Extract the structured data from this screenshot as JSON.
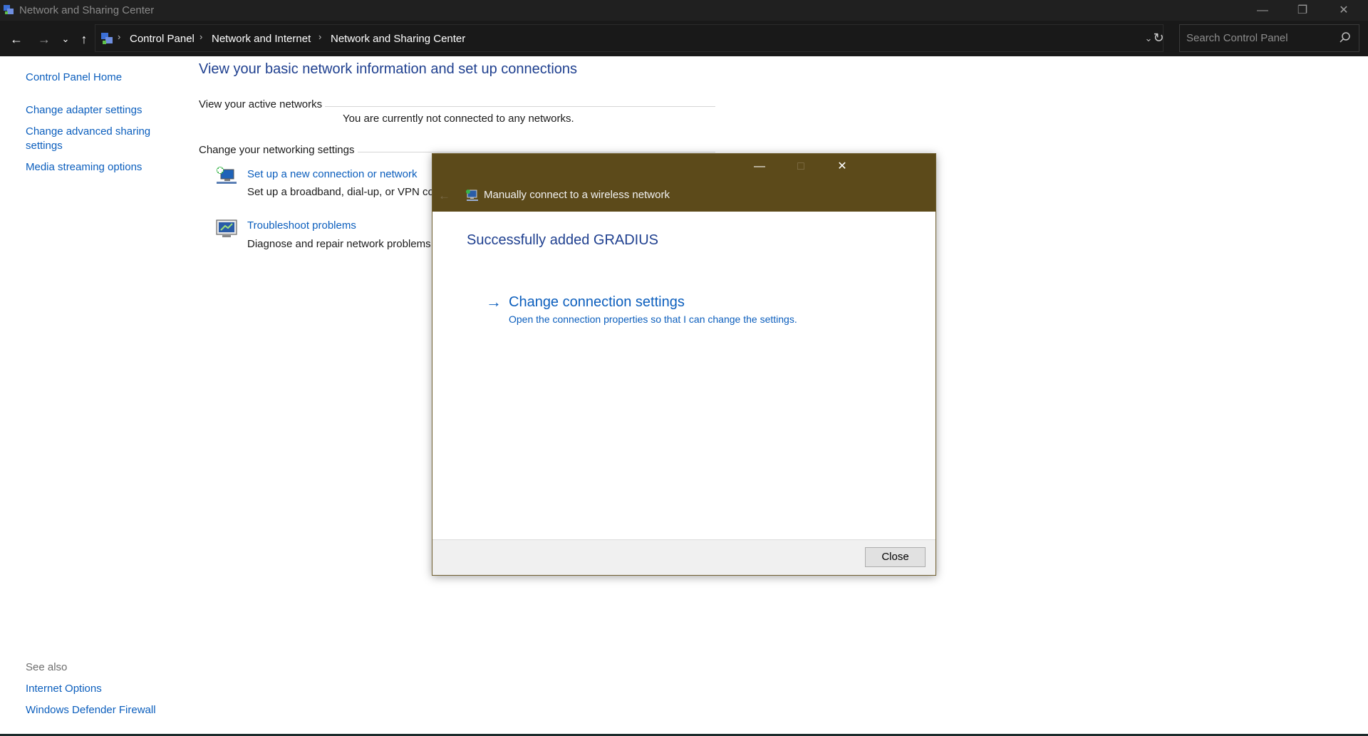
{
  "window": {
    "title": "Network and Sharing Center",
    "minimize_icon": "minimize-icon",
    "restore_icon": "restore-icon",
    "close_icon": "close-icon"
  },
  "address_bar": {
    "breadcrumbs": [
      "Control Panel",
      "Network and Internet",
      "Network and Sharing Center"
    ],
    "search_placeholder": "Search Control Panel"
  },
  "left_pane": {
    "home": "Control Panel Home",
    "links": [
      "Change adapter settings",
      "Change advanced sharing",
      "settings",
      "Media streaming options"
    ],
    "see_also_label": "See also",
    "see_also": [
      "Internet Options",
      "Windows Defender Firewall"
    ]
  },
  "main": {
    "heading": "View your basic network information and set up connections",
    "active_networks_title": "View your active networks",
    "not_connected": "You are currently not connected to any networks.",
    "change_settings_title": "Change your networking settings",
    "tasks": [
      {
        "title": "Set up a new connection or network",
        "desc": "Set up a broadband, dial-up, or VPN co"
      },
      {
        "title": "Troubleshoot problems",
        "desc": "Diagnose and repair network problems"
      }
    ]
  },
  "dialog": {
    "title": "Manually connect to a wireless network",
    "success": "Successfully added GRADIUS",
    "command_title": "Change connection settings",
    "command_desc": "Open the connection properties so that I can change the settings.",
    "close_button": "Close",
    "header_color": "#5c4a1a"
  },
  "colors": {
    "link": "#0b5ebd",
    "heading": "#1e3f8f",
    "titlebar": "#202020"
  }
}
